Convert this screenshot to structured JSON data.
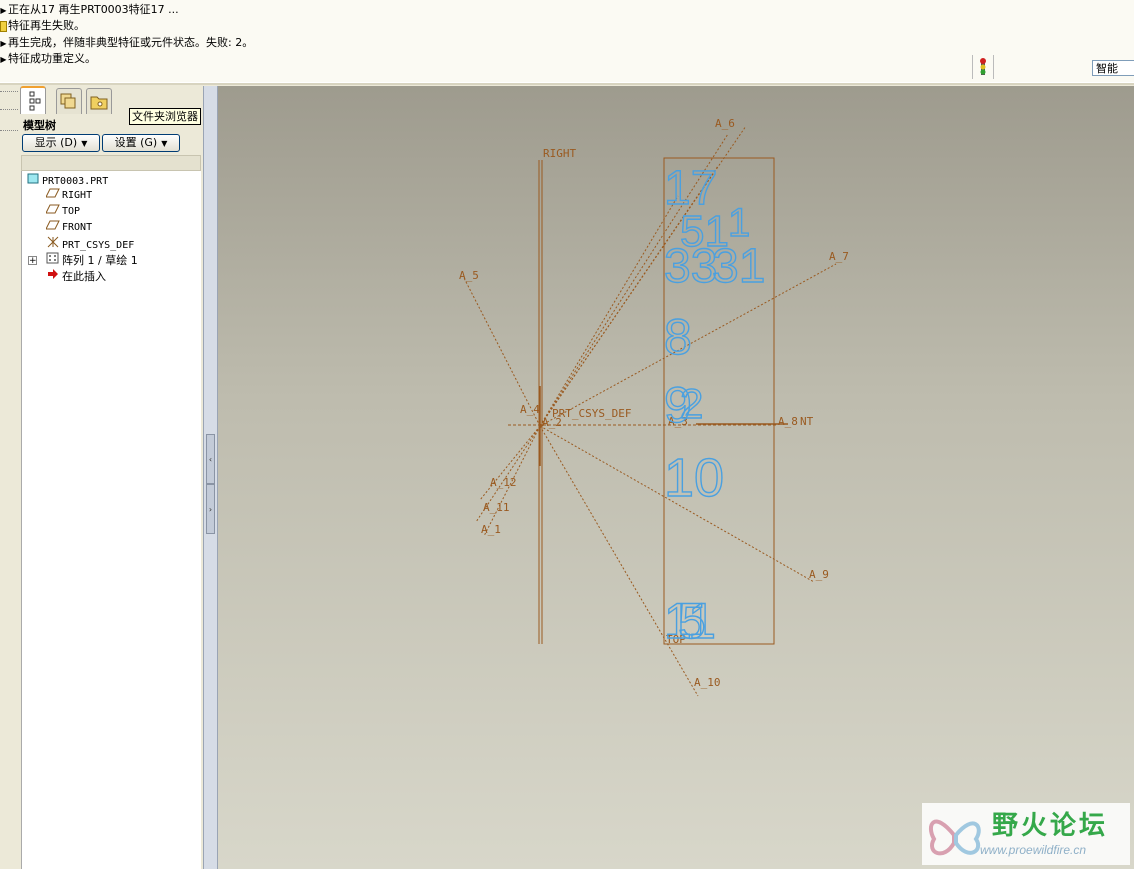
{
  "messages": [
    {
      "icon": "arrow",
      "text": "正在从17 再生PRT0003特征17 ..."
    },
    {
      "icon": "warn",
      "text": "特征再生失败。"
    },
    {
      "icon": "arrow",
      "text": "再生完成，伴随非典型特征或元件状态。失败: 2。"
    },
    {
      "icon": "arrow",
      "text": "特征成功重定义。"
    }
  ],
  "toolbar": {
    "filter_value": "智能"
  },
  "panel": {
    "tooltip": "文件夹浏览器",
    "title": "模型树",
    "show_button": "显示 (D)",
    "settings_button": "设置 (G)",
    "tree": [
      {
        "label": "PRT0003.PRT",
        "icon": "part-icon"
      },
      {
        "label": "RIGHT",
        "icon": "datum-plane-icon"
      },
      {
        "label": "TOP",
        "icon": "datum-plane-icon"
      },
      {
        "label": "FRONT",
        "icon": "datum-plane-icon"
      },
      {
        "label": "PRT_CSYS_DEF",
        "icon": "csys-icon"
      },
      {
        "label": "阵列 1 / 草绘 1",
        "icon": "pattern-icon"
      },
      {
        "label": "在此插入",
        "icon": "insert-arrow-icon"
      }
    ]
  },
  "graphics": {
    "datum_labels": {
      "right": "RIGHT",
      "top": "TOP",
      "csys": "PRT_CSYS_DEF",
      "a1": "A_1",
      "a2": "A_2",
      "a3": "A_3",
      "a4": "A_4",
      "a5": "A_5",
      "a6": "A_6",
      "a7": "A_7",
      "a8": "A_8",
      "a9": "A_9",
      "a10": "A_10",
      "a11": "A_11",
      "a12": "A_12",
      "nt": "NT"
    },
    "dimensions": [
      "17",
      "51",
      "1",
      "33",
      "31",
      "8",
      "9",
      "2",
      "10",
      "11",
      "5"
    ]
  },
  "watermark": {
    "title": "野火论坛",
    "url": "www.proewildfire.cn"
  },
  "colors": {
    "datum": "#9a5a20",
    "dimension": "#4aa0e0",
    "tree_bg": "#ffffff",
    "chrome": "#ece9d8"
  }
}
